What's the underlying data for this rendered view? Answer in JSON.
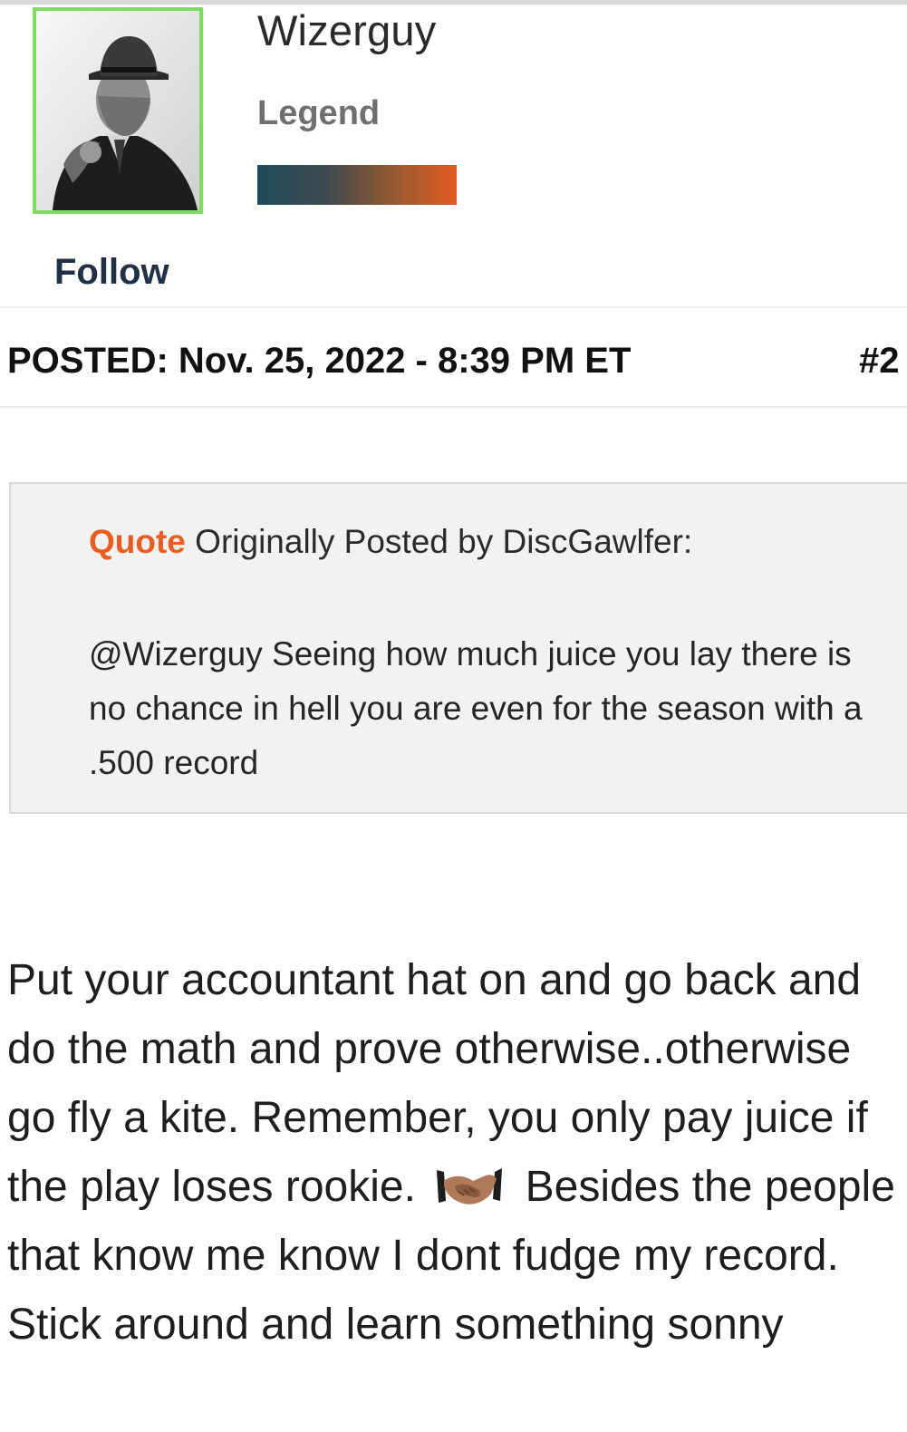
{
  "profile": {
    "username": "Wizerguy",
    "rank": "Legend",
    "follow_label": "Follow"
  },
  "post": {
    "posted_meta": "POSTED: Nov. 25, 2022 - 8:39 PM ET",
    "post_number": "#2"
  },
  "quote": {
    "tag": "Quote",
    "attribution": " Originally Posted by DiscGawlfer:",
    "text": "@Wizerguy  Seeing how much juice you lay there is no chance in hell you are even for the season with a .500 record"
  },
  "body": {
    "text_before_emoji": "Put your accountant hat on and go back and do the math and prove otherwise..otherwise go fly a kite. Remember, you only pay  juice if the play loses rookie.",
    "emoji_icon": "handshake-icon",
    "text_after_emoji": "Besides the people that know me know I dont fudge my record. Stick around and learn something sonny"
  },
  "colors": {
    "quote_accent": "#e85d22",
    "avatar_border": "#7fdc62",
    "rank_bar_start": "#1f4b5c",
    "rank_bar_end": "#e35b25"
  }
}
